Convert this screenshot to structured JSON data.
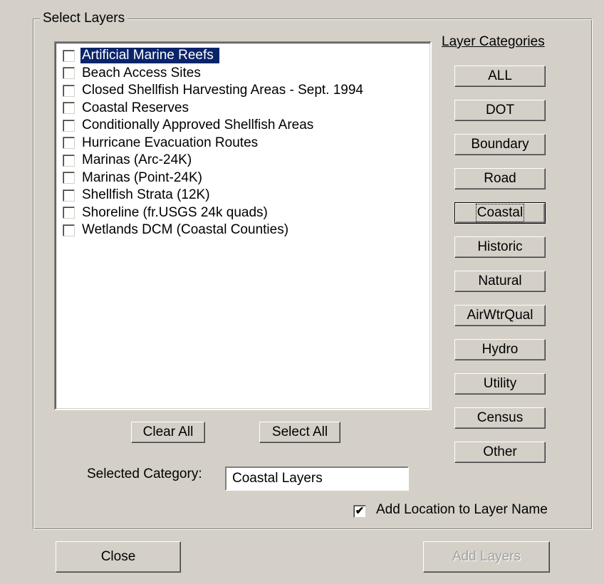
{
  "group": {
    "title": "Select Layers"
  },
  "layers": [
    {
      "label": "Artificial Marine Reefs",
      "checked": false,
      "selected": true
    },
    {
      "label": "Beach Access Sites",
      "checked": false,
      "selected": false
    },
    {
      "label": "Closed Shellfish Harvesting Areas - Sept. 1994",
      "checked": false,
      "selected": false
    },
    {
      "label": "Coastal Reserves",
      "checked": false,
      "selected": false
    },
    {
      "label": "Conditionally Approved Shellfish Areas",
      "checked": false,
      "selected": false
    },
    {
      "label": "Hurricane Evacuation Routes",
      "checked": false,
      "selected": false
    },
    {
      "label": "Marinas (Arc-24K)",
      "checked": false,
      "selected": false
    },
    {
      "label": "Marinas (Point-24K)",
      "checked": false,
      "selected": false
    },
    {
      "label": "Shellfish Strata (12K)",
      "checked": false,
      "selected": false
    },
    {
      "label": "Shoreline (fr.USGS 24k quads)",
      "checked": false,
      "selected": false
    },
    {
      "label": "Wetlands DCM (Coastal Counties)",
      "checked": false,
      "selected": false
    }
  ],
  "categories": {
    "heading": "Layer Categories",
    "buttons": [
      "ALL",
      "DOT",
      "Boundary",
      "Road",
      "Coastal",
      "Historic",
      "Natural",
      "AirWtrQual",
      "Hydro",
      "Utility",
      "Census",
      "Other"
    ],
    "focused": "Coastal"
  },
  "list_buttons": {
    "clear_all": "Clear All",
    "select_all": "Select All"
  },
  "selected_category": {
    "label": "Selected Category:",
    "value": "Coastal Layers"
  },
  "add_location": {
    "label": "Add Location to Layer Name",
    "checked": true,
    "mark": "✔"
  },
  "footer": {
    "close": "Close",
    "add_layers": "Add Layers"
  }
}
